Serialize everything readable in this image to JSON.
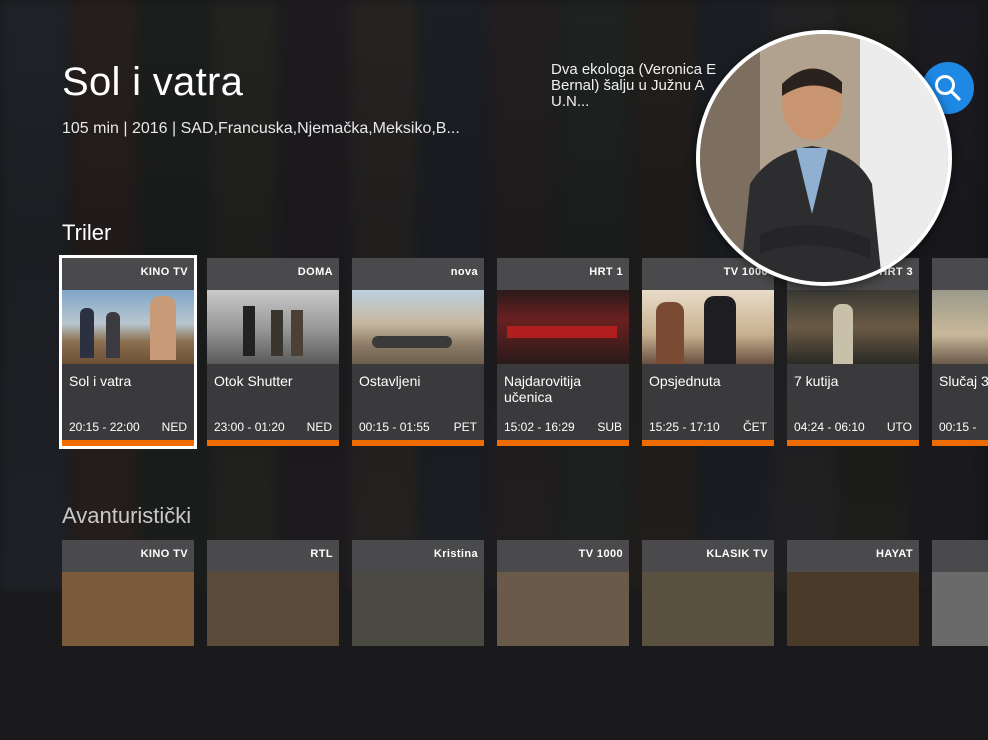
{
  "movie": {
    "title": "Sol i vatra",
    "meta": "105 min | 2016 | SAD,Francuska,Njemačka,Meksiko,B...",
    "description_line1": "Dva ekologa (Veronica E",
    "description_line2": "Bernal) šalju u Južnu A",
    "description_line3": "U.N..."
  },
  "search": {
    "icon": "search-icon",
    "color": "#1e88e5"
  },
  "sections": [
    {
      "label": "Triler",
      "cards": [
        {
          "channel": "KINO TV",
          "title": "Sol i vatra",
          "time": "20:15 - 22:00",
          "day": "NED",
          "selected": true
        },
        {
          "channel": "DOMA",
          "title": "Otok Shutter",
          "time": "23:00 - 01:20",
          "day": "NED"
        },
        {
          "channel": "nova",
          "title": "Ostavljeni",
          "time": "00:15 - 01:55",
          "day": "PET"
        },
        {
          "channel": "HRT 1",
          "title": "Najdarovitija učenica",
          "time": "15:02 - 16:29",
          "day": "SUB"
        },
        {
          "channel": "TV 1000",
          "title": "Opsjednuta",
          "time": "15:25 - 17:10",
          "day": "ČET"
        },
        {
          "channel": "HRT 3",
          "title": "7 kutija",
          "time": "04:24 - 06:10",
          "day": "UTO"
        },
        {
          "channel": "",
          "title": "Slučaj 3",
          "time": "00:15 -",
          "day": ""
        }
      ]
    },
    {
      "label": "Avanturistički",
      "cards": [
        {
          "channel": "KINO TV"
        },
        {
          "channel": "RTL"
        },
        {
          "channel": "Kristina"
        },
        {
          "channel": "TV 1000"
        },
        {
          "channel": "KLASIK TV"
        },
        {
          "channel": "HAYAT"
        },
        {
          "channel": ""
        }
      ]
    }
  ],
  "accent": "#ef6c00"
}
